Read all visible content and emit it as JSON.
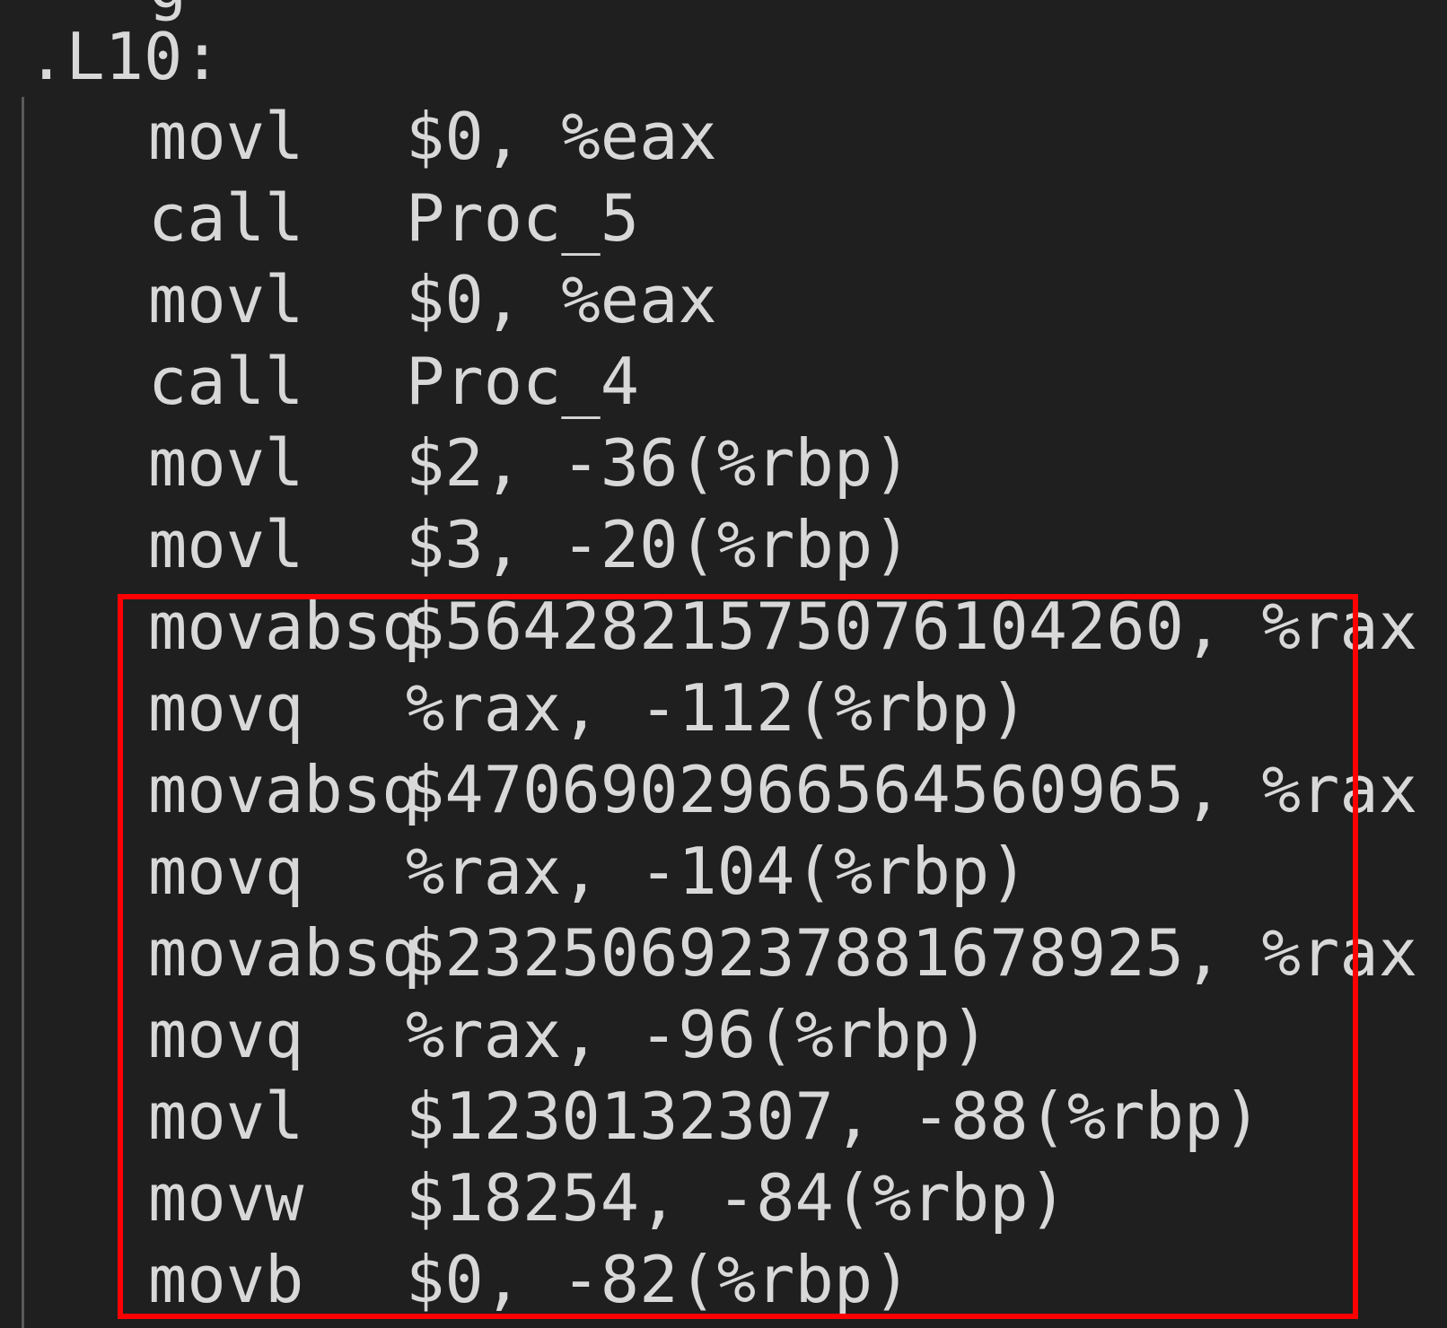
{
  "cutoff_text": "g",
  "label": ".L10:",
  "lines": [
    {
      "opcode": "movl",
      "operands": "$0, %eax"
    },
    {
      "opcode": "call",
      "operands": "Proc_5"
    },
    {
      "opcode": "movl",
      "operands": "$0, %eax"
    },
    {
      "opcode": "call",
      "operands": "Proc_4"
    },
    {
      "opcode": "movl",
      "operands": "$2, -36(%rbp)"
    },
    {
      "opcode": "movl",
      "operands": "$3, -20(%rbp)"
    },
    {
      "opcode": "movabsq",
      "operands": "$5642821575076104260, %rax"
    },
    {
      "opcode": "movq",
      "operands": "%rax, -112(%rbp)"
    },
    {
      "opcode": "movabsq",
      "operands": "$4706902966564560965, %rax"
    },
    {
      "opcode": "movq",
      "operands": "%rax, -104(%rbp)"
    },
    {
      "opcode": "movabsq",
      "operands": "$2325069237881678925, %rax"
    },
    {
      "opcode": "movq",
      "operands": "%rax, -96(%rbp)"
    },
    {
      "opcode": "movl",
      "operands": "$1230132307, -88(%rbp)"
    },
    {
      "opcode": "movw",
      "operands": "$18254, -84(%rbp)"
    },
    {
      "opcode": "movb",
      "operands": "$0, -82(%rbp)"
    }
  ],
  "colors": {
    "background": "#1f1f1f",
    "text": "#d8d8d8",
    "highlight_border": "#ff0000",
    "indent_guide": "#5a5a5a"
  }
}
